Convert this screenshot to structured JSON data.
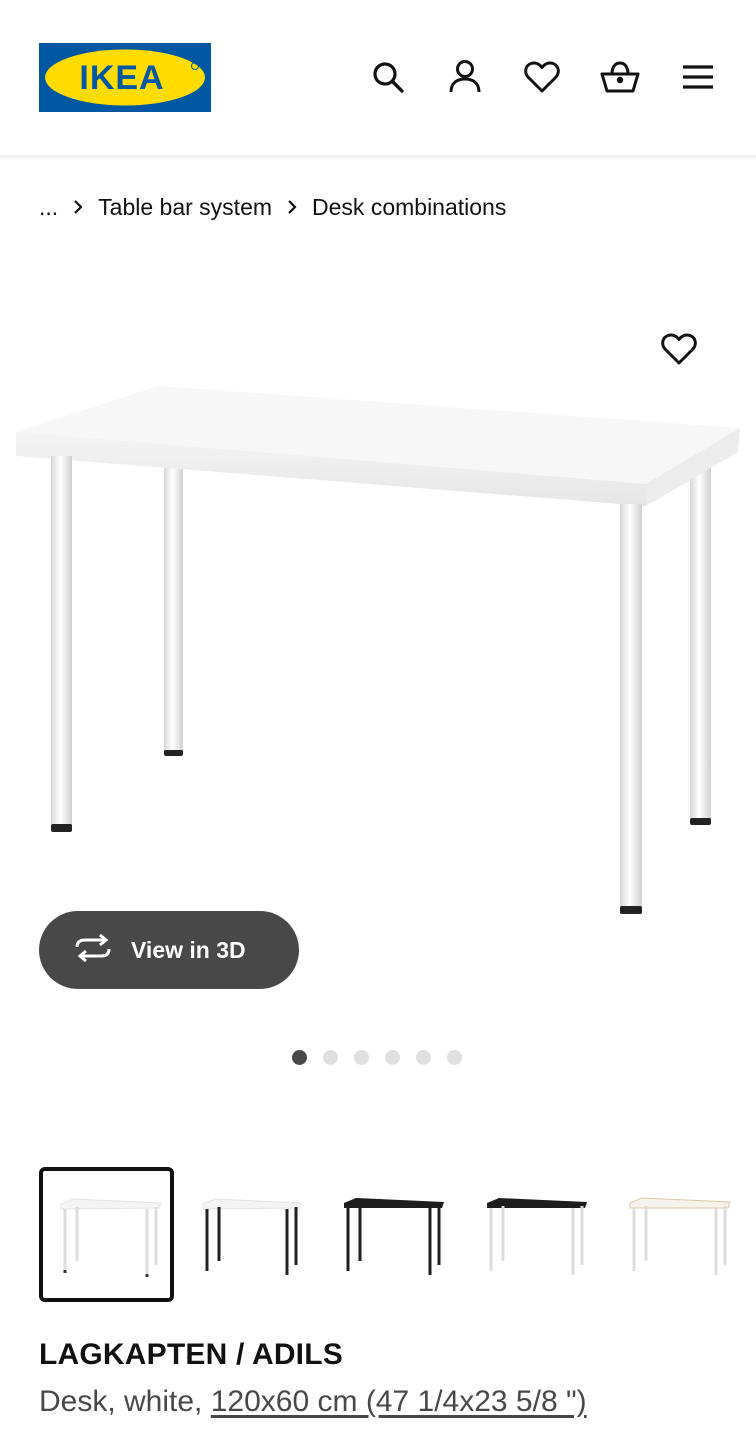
{
  "brand": {
    "logo_text": "IKEA",
    "colors": {
      "blue": "#0058a3",
      "yellow": "#ffdb00"
    }
  },
  "header": {
    "icons": [
      "search-icon",
      "account-icon",
      "favourites-icon",
      "basket-icon",
      "menu-icon"
    ]
  },
  "breadcrumb": {
    "ellipsis": "...",
    "items": [
      "Table bar system",
      "Desk combinations"
    ]
  },
  "product_image": {
    "view3d_label": "View in 3D",
    "dots_total": 6,
    "active_dot": 1
  },
  "variants": [
    {
      "name": "white-desk-white-legs",
      "top": "white",
      "legs": "white",
      "selected": true
    },
    {
      "name": "white-desk-black-legs",
      "top": "white",
      "legs": "black",
      "selected": false
    },
    {
      "name": "black-desk-black-legs",
      "top": "black",
      "legs": "black",
      "selected": false
    },
    {
      "name": "black-desk-white-legs",
      "top": "black",
      "legs": "white",
      "selected": false
    },
    {
      "name": "birch-desk-white-legs",
      "top": "birch",
      "legs": "white",
      "selected": false
    }
  ],
  "product": {
    "name": "LAGKAPTEN / ADILS",
    "desc_prefix": "Desk, white, ",
    "size": "120x60 cm (47 1/4x23 5/8 \")"
  }
}
